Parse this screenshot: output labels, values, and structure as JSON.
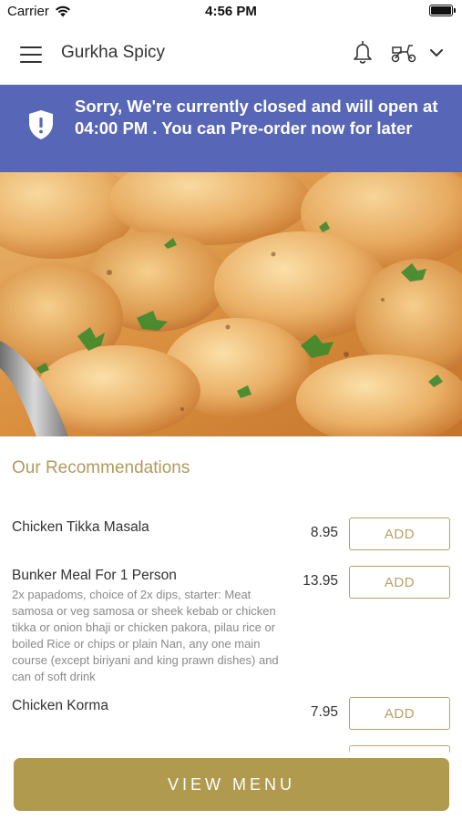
{
  "status_bar": {
    "carrier": "Carrier",
    "time": "4:56 PM",
    "icons": [
      "wifi-icon",
      "battery-icon"
    ]
  },
  "header": {
    "title": "Gurkha Spicy",
    "icons": [
      "hamburger-menu-icon",
      "bell-icon",
      "scooter-icon",
      "chevron-down-icon"
    ]
  },
  "banner": {
    "message": "Sorry, We're currently closed and will open at 04:00 PM . You can Pre-order now for later",
    "icon": "shield-alert-icon",
    "background_color": "#5766b6"
  },
  "recommendations": {
    "title": "Our Recommendations",
    "add_label": "ADD",
    "items": [
      {
        "name": "Chicken Tikka Masala",
        "price": "8.95",
        "description": ""
      },
      {
        "name": "Bunker Meal For 1 Person",
        "price": "13.95",
        "description": "2x papadoms, choice of 2x dips, starter: Meat samosa or veg samosa or sheek kebab or chicken tikka or onion bhaji or chicken pakora, pilau rice or boiled Rice or chips or plain Nan, any one main course (except biriyani and king prawn dishes) and can of soft drink"
      },
      {
        "name": "Chicken Korma",
        "price": "7.95",
        "description": ""
      }
    ]
  },
  "footer": {
    "view_menu_label": "VIEW MENU",
    "accent_color": "#b09a4d"
  }
}
